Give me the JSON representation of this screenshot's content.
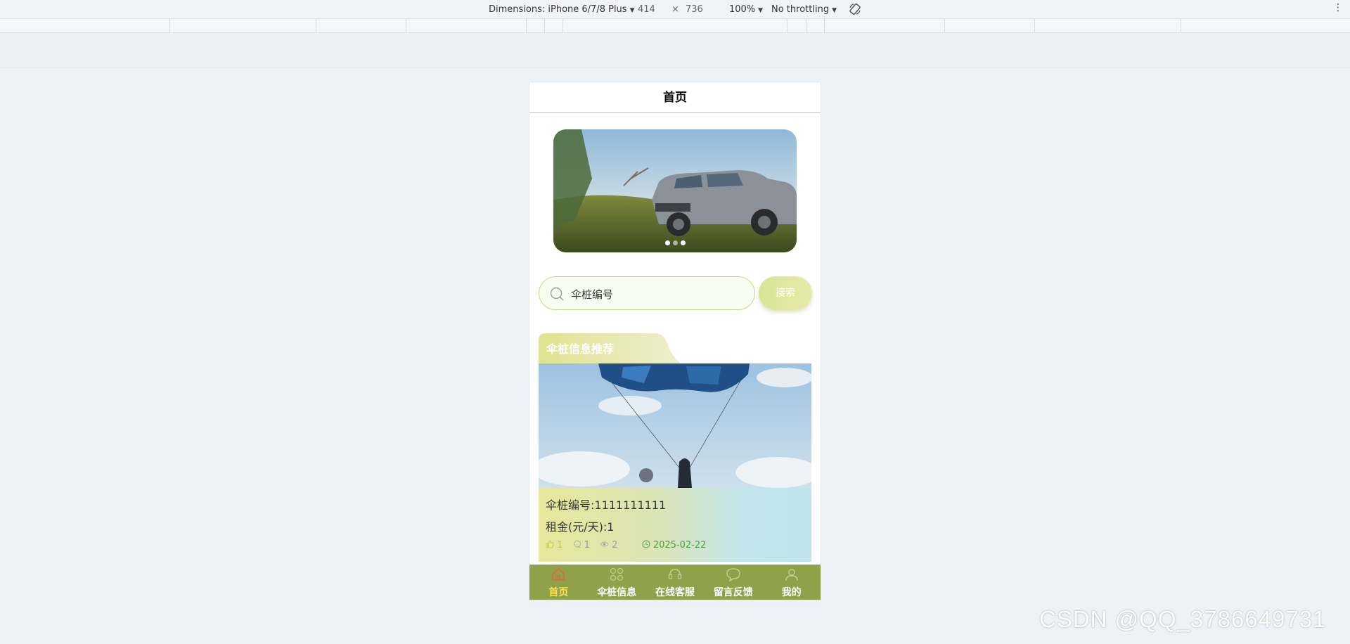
{
  "devtools": {
    "dimensions_label": "Dimensions: iPhone 6/7/8 Plus",
    "width": "414",
    "times": "×",
    "height": "736",
    "zoom": "100%",
    "throttling": "No throttling"
  },
  "page": {
    "title": "首页",
    "banner_dots": 3,
    "search": {
      "placeholder": "伞桩编号",
      "button": "搜索"
    },
    "section_title": "伞桩信息推荐",
    "card": {
      "number_label": "伞桩编号:1111111111",
      "rent_label": "租金(元/天):1",
      "likes": "1",
      "comments": "1",
      "views": "2",
      "date": "2025-02-22"
    },
    "tabbar": [
      {
        "label": "首页",
        "icon": "home-icon"
      },
      {
        "label": "伞桩信息",
        "icon": "grid-icon"
      },
      {
        "label": "在线客服",
        "icon": "service-icon"
      },
      {
        "label": "留言反馈",
        "icon": "chat-icon"
      },
      {
        "label": "我的",
        "icon": "user-icon"
      }
    ]
  },
  "watermark": "CSDN @QQ_3786649731"
}
